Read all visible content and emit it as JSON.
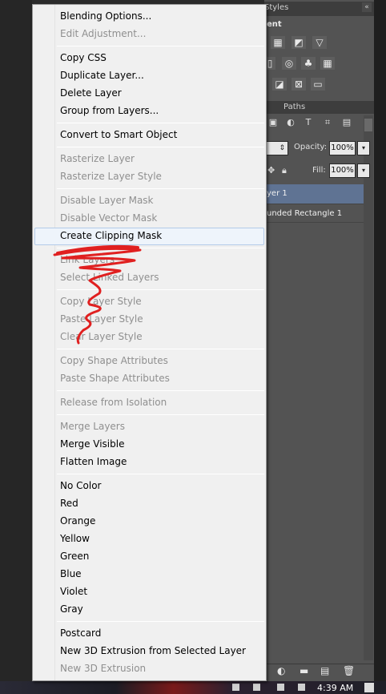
{
  "panel": {
    "styles_tab": "Styles",
    "adjustments_title": "ent",
    "paths_tab": "Paths",
    "opacity_label": "Opacity:",
    "opacity_value": "100%",
    "fill_label": "Fill:",
    "fill_value": "100%",
    "layers": [
      "yer 1",
      "unded Rectangle 1"
    ],
    "selected_layer_color": "#5f7393"
  },
  "menu": {
    "items": [
      {
        "label": "Blending Options...",
        "enabled": true
      },
      {
        "label": "Edit Adjustment...",
        "enabled": false
      },
      {
        "label": "Copy CSS",
        "enabled": true
      },
      {
        "label": "Duplicate Layer...",
        "enabled": true
      },
      {
        "label": "Delete Layer",
        "enabled": true
      },
      {
        "label": "Group from Layers...",
        "enabled": true
      },
      {
        "label": "Convert to Smart Object",
        "enabled": true
      },
      {
        "label": "Rasterize Layer",
        "enabled": false
      },
      {
        "label": "Rasterize Layer Style",
        "enabled": false
      },
      {
        "label": "Disable Layer Mask",
        "enabled": false
      },
      {
        "label": "Disable Vector Mask",
        "enabled": false
      },
      {
        "label": "Create Clipping Mask",
        "enabled": true,
        "highlighted": true
      },
      {
        "label": "Link Layers",
        "enabled": false
      },
      {
        "label": "Select Linked Layers",
        "enabled": false
      },
      {
        "label": "Copy Layer Style",
        "enabled": false
      },
      {
        "label": "Paste Layer Style",
        "enabled": false
      },
      {
        "label": "Clear Layer Style",
        "enabled": false
      },
      {
        "label": "Copy Shape Attributes",
        "enabled": false
      },
      {
        "label": "Paste Shape Attributes",
        "enabled": false
      },
      {
        "label": "Release from Isolation",
        "enabled": false
      },
      {
        "label": "Merge Layers",
        "enabled": false
      },
      {
        "label": "Merge Visible",
        "enabled": true
      },
      {
        "label": "Flatten Image",
        "enabled": true
      },
      {
        "label": "No Color",
        "enabled": true
      },
      {
        "label": "Red",
        "enabled": true
      },
      {
        "label": "Orange",
        "enabled": true
      },
      {
        "label": "Yellow",
        "enabled": true
      },
      {
        "label": "Green",
        "enabled": true
      },
      {
        "label": "Blue",
        "enabled": true
      },
      {
        "label": "Violet",
        "enabled": true
      },
      {
        "label": "Gray",
        "enabled": true
      },
      {
        "label": "Postcard",
        "enabled": true
      },
      {
        "label": "New 3D Extrusion from Selected Layer",
        "enabled": true
      },
      {
        "label": "New 3D Extrusion",
        "enabled": false
      }
    ],
    "highlight_color": "#eef4fb",
    "annotation_color": "#e02020"
  },
  "taskbar": {
    "clock": "4:39 AM"
  }
}
